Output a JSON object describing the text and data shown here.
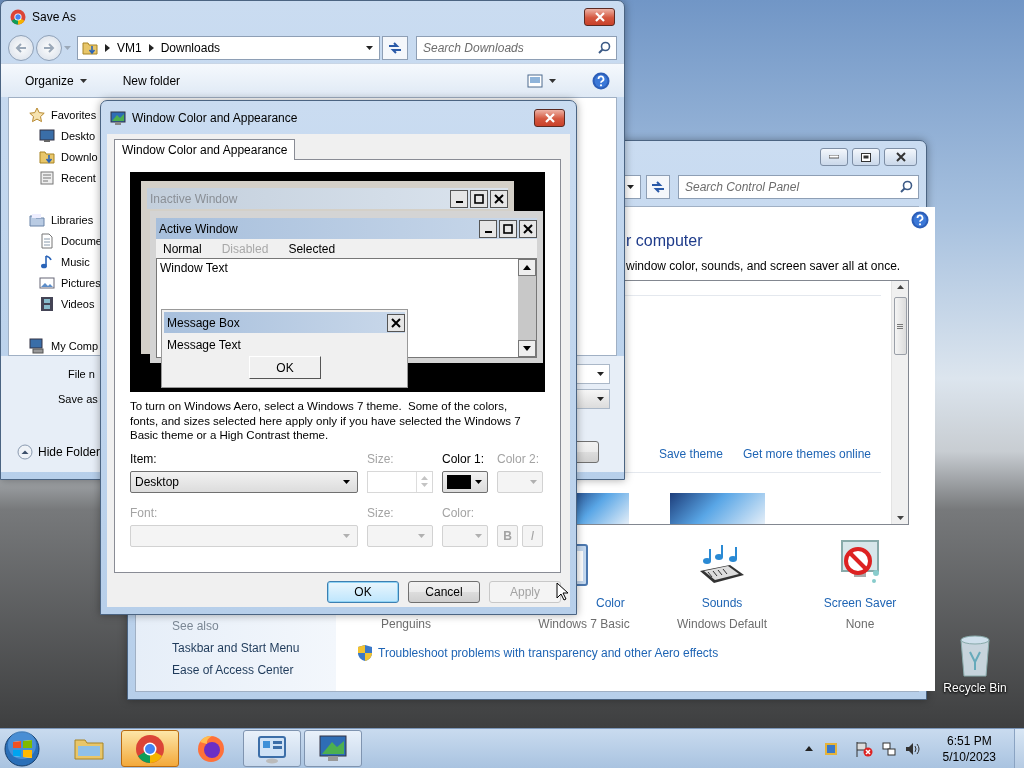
{
  "save_as": {
    "title": "Save As",
    "path": [
      "VM1",
      "Downloads"
    ],
    "search": {
      "placeholder": "Search Downloads"
    },
    "toolbar": [
      "Organize",
      "New folder"
    ],
    "nav": [
      {
        "label": "Favorites",
        "kind": "favorites",
        "children": [
          {
            "label": "Deskto",
            "kind": "desktop"
          },
          {
            "label": "Downlo",
            "kind": "downloads"
          },
          {
            "label": "Recent",
            "kind": "recent"
          }
        ]
      },
      {
        "label": "Libraries",
        "kind": "libraries",
        "children": [
          {
            "label": "Docume",
            "kind": "documents"
          },
          {
            "label": "Music",
            "kind": "music"
          },
          {
            "label": "Pictures",
            "kind": "pictures"
          },
          {
            "label": "Videos",
            "kind": "videos"
          }
        ]
      },
      {
        "label": "My Comp",
        "kind": "computer"
      }
    ],
    "fields": [
      "File n",
      "Save as"
    ],
    "hide_folders": "Hide Folder"
  },
  "control_panel": {
    "search": {
      "placeholder": "Search Control Panel"
    },
    "heading": "r computer",
    "description": "window color, sounds, and screen saver all at once.",
    "theme_links": [
      "Save theme",
      "Get more themes online"
    ],
    "items": [
      {
        "kind": "background",
        "subtitle": "Penguins"
      },
      {
        "kind": "color",
        "label": "Color",
        "subtitle": "Windows 7 Basic"
      },
      {
        "kind": "sounds",
        "label": "Sounds",
        "subtitle": "Windows Default"
      },
      {
        "kind": "screensaver",
        "label": "Screen Saver",
        "subtitle": "None"
      }
    ],
    "see_also": {
      "heading": "See also",
      "links": [
        "Taskbar and Start Menu",
        "Ease of Access Center"
      ]
    },
    "troubleshoot": "Troubleshoot problems with transparency and other Aero effects"
  },
  "dialog": {
    "title": "Window Color and Appearance",
    "tabs": [
      {
        "label": "Window Color and Appearance",
        "selected": true
      }
    ],
    "preview": {
      "inactive_title": "Inactive Window",
      "active_title": "Active Window",
      "menu": [
        {
          "label": "Normal",
          "disabled": false
        },
        {
          "label": "Disabled",
          "disabled": true
        },
        {
          "label": "Selected",
          "disabled": false
        }
      ],
      "window_text": "Window Text",
      "message_title": "Message Box",
      "message_text": "Message Text",
      "ok": "OK"
    },
    "description": "To turn on Windows Aero, select a Windows 7 theme.  Some of the colors, fonts, and sizes selected here apply only if you have selected the Windows 7 Basic theme or a High Contrast theme.",
    "controls": [
      {
        "label": "Item:",
        "kind": "dropdown",
        "value": "Desktop",
        "disabled": false
      },
      {
        "label": "Size:",
        "kind": "spinner",
        "disabled": true
      },
      {
        "label": "Color 1:",
        "kind": "color",
        "color": "#000000",
        "disabled": false
      },
      {
        "label": "Color 2:",
        "kind": "color",
        "disabled": true
      },
      {
        "label": "Font:",
        "kind": "dropdown",
        "disabled": true
      },
      {
        "label": "Size:",
        "kind": "dropdown",
        "disabled": true
      },
      {
        "label": "Color:",
        "kind": "color",
        "disabled": true
      },
      {
        "kind": "style_buttons",
        "buttons": [
          "B",
          "I"
        ],
        "disabled": true
      }
    ],
    "buttons": [
      {
        "label": "OK",
        "default": true,
        "disabled": false
      },
      {
        "label": "Cancel",
        "default": false,
        "disabled": false
      },
      {
        "label": "Apply",
        "default": false,
        "disabled": true
      }
    ]
  },
  "desktop_icons": [
    {
      "label": "Recycle Bin"
    }
  ],
  "taskbar": {
    "items": [
      {
        "kind": "explorer",
        "open": false,
        "selected": false
      },
      {
        "kind": "chrome",
        "open": true,
        "selected": true
      },
      {
        "kind": "firefox",
        "open": false,
        "selected": false
      },
      {
        "kind": "control_panel",
        "open": true,
        "selected": false
      },
      {
        "kind": "display",
        "open": true,
        "selected": false
      }
    ],
    "time": "6:51 PM",
    "date": "5/10/2023"
  }
}
